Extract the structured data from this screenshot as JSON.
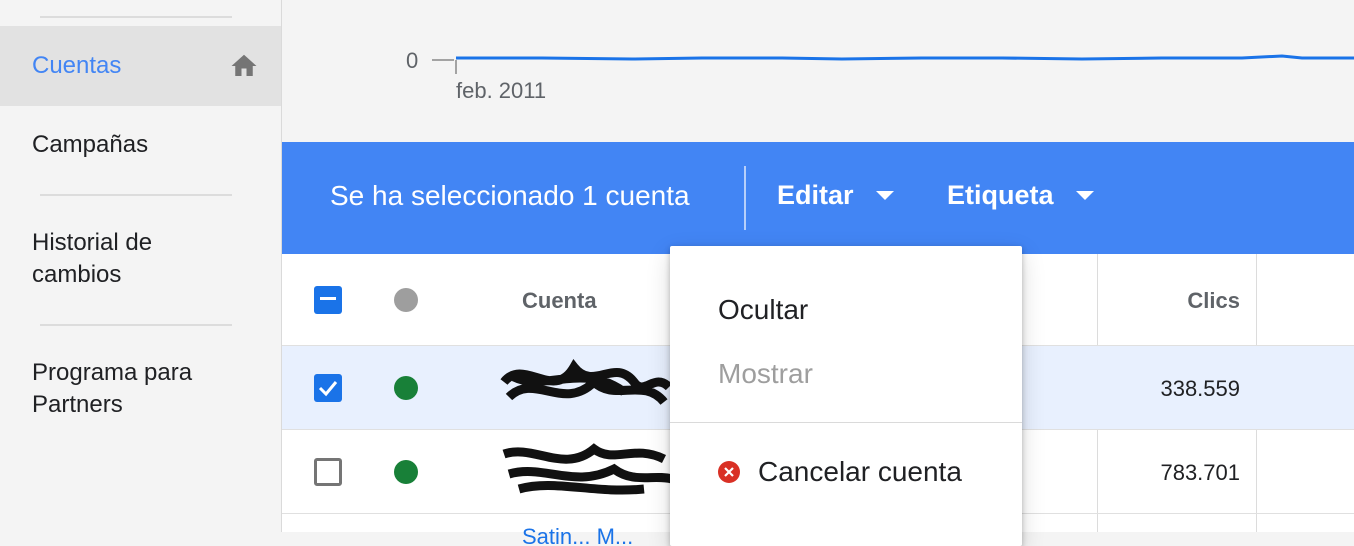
{
  "sidebar": {
    "items": [
      {
        "label": "Cuentas"
      },
      {
        "label": "Campañas"
      },
      {
        "label": "Historial de cambios"
      },
      {
        "label": "Programa para Partners"
      }
    ]
  },
  "chart_data": {
    "type": "line",
    "y_tick": "0",
    "x_tick": "feb. 2011",
    "line_color": "#1a73e8"
  },
  "selection_bar": {
    "text": "Se ha seleccionado 1 cuenta",
    "edit_label": "Editar",
    "label_label": "Etiqueta",
    "bg_color": "#4285f4"
  },
  "table": {
    "headers": {
      "account": "Cuenta",
      "clicks": "Clics"
    },
    "rows": [
      {
        "clicks": "338.559",
        "status_color": "#188038",
        "selected": true
      },
      {
        "clicks": "783.701",
        "status_color": "#188038",
        "selected": false
      }
    ],
    "partial_link": "Satin... M..."
  },
  "dropdown": {
    "items": [
      {
        "label": "Ocultar",
        "disabled": false
      },
      {
        "label": "Mostrar",
        "disabled": true
      },
      {
        "label": "Cancelar cuenta",
        "icon": "cancel-icon",
        "disabled": false
      }
    ]
  }
}
